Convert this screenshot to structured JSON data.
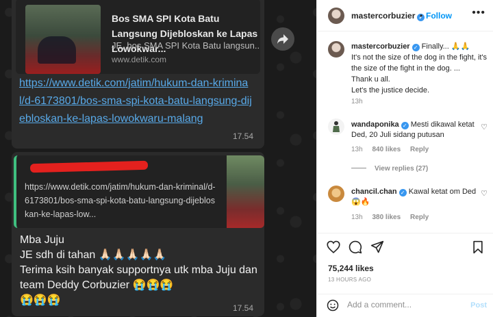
{
  "chat": {
    "preview1": {
      "title": "Bos SMA SPI Kota Batu Langsung Dijebloskan ke Lapas Lowokwar...",
      "description": "JE, bos SMA SPI Kota Batu langsun...",
      "domain": "www.detik.com"
    },
    "link1": "https://www.detik.com/jatim/hukum-dan-kriminal/d-6173801/bos-sma-spi-kota-batu-langsung-dijebloskan-ke-lapas-lowokwaru-malang",
    "time1": "17.54",
    "preview2": {
      "url": "https://www.detik.com/jatim/hukum-dan-kriminal/d-6173801/bos-sma-spi-kota-batu-langsung-dijebloskan-ke-lapas-low..."
    },
    "message": {
      "line1": "Mba Juju",
      "line2": "JE sdh di tahan 🙏🏻🙏🏻🙏🏻🙏🏻🙏🏻",
      "line3": "Terima ksih banyak supportnya utk mba Juju dan team Deddy Corbuzier 😭😭😭",
      "line4": "😭😭😭"
    },
    "time2": "17.54"
  },
  "header": {
    "username": "mastercorbuzier",
    "separator": "•",
    "follow_label": "Follow",
    "more_icon": "more-horizontal-icon"
  },
  "caption": {
    "username": "mastercorbuzier",
    "text_line1": "Finally... 🙏🙏",
    "text_line2": "It's not the size of the dog in the fight, it's the size of the fight in the dog. ...",
    "text_line3": "Thank u all.",
    "text_line4": "Let's the justice decide.",
    "time": "13h"
  },
  "comments": [
    {
      "username": "wandaponika",
      "text": "Mesti dikawal ketat Ded, 20 Juli sidang putusan",
      "time": "13h",
      "likes": "840 likes",
      "reply": "Reply",
      "view_replies": "View replies (27)"
    },
    {
      "username": "chancil.chan",
      "text": "Kawal ketat om Ded 😱🔥",
      "time": "13h",
      "likes": "380 likes",
      "reply": "Reply"
    }
  ],
  "actions": {
    "likes": "75,244 likes",
    "ago": "13 HOURS AGO"
  },
  "add_comment": {
    "placeholder": "Add a comment...",
    "post_label": "Post"
  },
  "colors": {
    "link": "#58a9e8",
    "accent": "#0095f6",
    "verified": "#3897f0",
    "redaction": "#e4211e"
  }
}
